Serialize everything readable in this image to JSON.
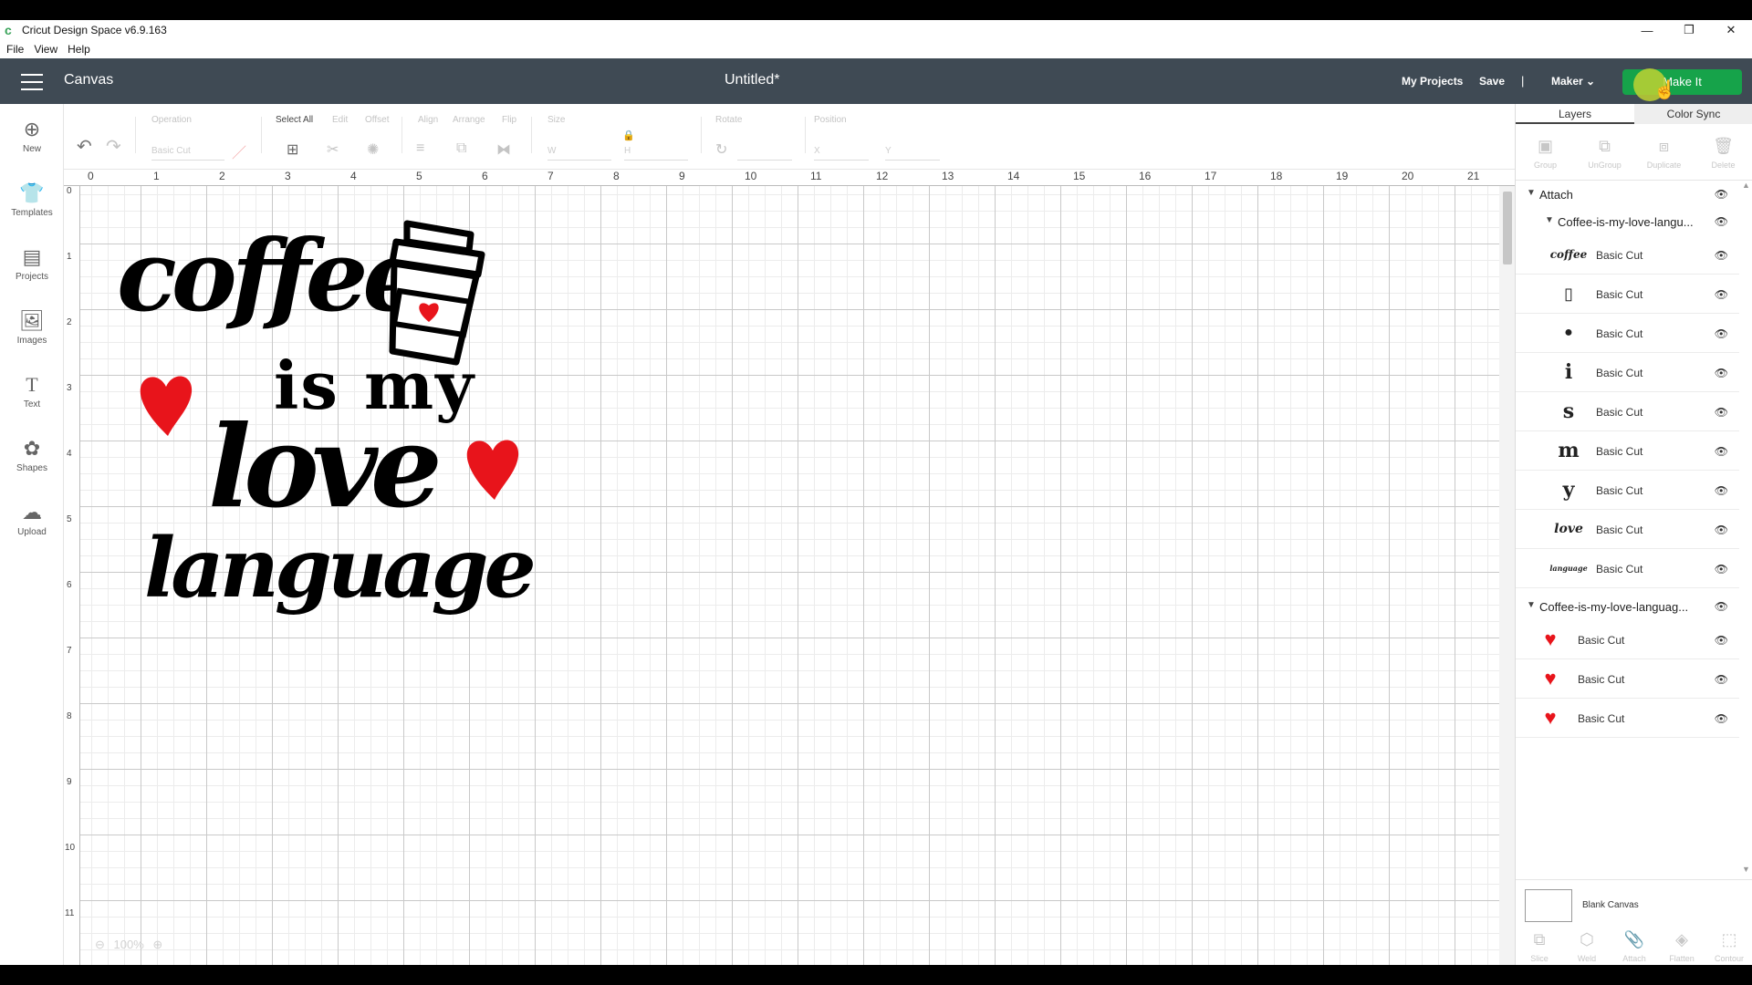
{
  "window": {
    "title": "Cricut Design Space  v6.9.163",
    "controls": [
      "—",
      "❐",
      "✕"
    ]
  },
  "menu": [
    "File",
    "View",
    "Help"
  ],
  "header": {
    "section": "Canvas",
    "doc_title": "Untitled*",
    "my_projects": "My Projects",
    "save": "Save",
    "separator": "|",
    "machine": "Maker",
    "make_it": "Make It"
  },
  "sidebar": [
    {
      "label": "New",
      "icon": "plus-circle-icon",
      "glyph": "⊕"
    },
    {
      "label": "Templates",
      "icon": "tshirt-icon",
      "glyph": "👕"
    },
    {
      "label": "Projects",
      "icon": "projects-icon",
      "glyph": "▤"
    },
    {
      "label": "Images",
      "icon": "image-icon",
      "glyph": "🖼"
    },
    {
      "label": "Text",
      "icon": "text-icon",
      "glyph": "T"
    },
    {
      "label": "Shapes",
      "icon": "shapes-icon",
      "glyph": "✿"
    },
    {
      "label": "Upload",
      "icon": "upload-cloud-icon",
      "glyph": "☁"
    }
  ],
  "toolbar": {
    "operation_label": "Operation",
    "operation_value": "Basic Cut",
    "select_all": "Select All",
    "edit": "Edit",
    "offset": "Offset",
    "align": "Align",
    "arrange": "Arrange",
    "flip": "Flip",
    "size": "Size",
    "w": "W",
    "h": "H",
    "rotate": "Rotate",
    "position": "Position",
    "x": "X",
    "y": "Y",
    "zoom": "100%"
  },
  "ruler": {
    "top": [
      "0",
      "1",
      "2",
      "3",
      "4",
      "5",
      "6",
      "7",
      "8",
      "9",
      "10",
      "11",
      "12",
      "13",
      "14",
      "15",
      "16",
      "17",
      "18",
      "19",
      "20",
      "21"
    ],
    "left": [
      "0",
      "1",
      "2",
      "3",
      "4",
      "5",
      "6",
      "7",
      "8",
      "9",
      "10",
      "11"
    ]
  },
  "design": {
    "line1": "coffee",
    "line2": "is my",
    "line3": "love",
    "line4": "language",
    "colors": {
      "ink": "#000000",
      "heart": "#e8141b"
    }
  },
  "panel": {
    "tabs": [
      "Layers",
      "Color Sync"
    ],
    "actions": [
      "Group",
      "UnGroup",
      "Duplicate",
      "Delete"
    ],
    "attach_group": "Attach",
    "group1_name": "Coffee-is-my-love-langu...",
    "group1_items": [
      {
        "thumb": "coffee",
        "label": "Basic Cut"
      },
      {
        "thumb": "cup",
        "label": "Basic Cut"
      },
      {
        "thumb": "dot",
        "label": "Basic Cut"
      },
      {
        "thumb": "i",
        "label": "Basic Cut"
      },
      {
        "thumb": "s",
        "label": "Basic Cut"
      },
      {
        "thumb": "m",
        "label": "Basic Cut"
      },
      {
        "thumb": "y",
        "label": "Basic Cut"
      },
      {
        "thumb": "love",
        "label": "Basic Cut"
      },
      {
        "thumb": "language",
        "label": "Basic Cut"
      }
    ],
    "group2_name": "Coffee-is-my-love-languag...",
    "group2_items": [
      {
        "thumb": "heart",
        "label": "Basic Cut"
      },
      {
        "thumb": "heart",
        "label": "Basic Cut"
      },
      {
        "thumb": "heart",
        "label": "Basic Cut"
      }
    ],
    "blank_canvas": "Blank Canvas",
    "bottom_actions": [
      "Slice",
      "Weld",
      "Attach",
      "Flatten",
      "Contour"
    ]
  }
}
